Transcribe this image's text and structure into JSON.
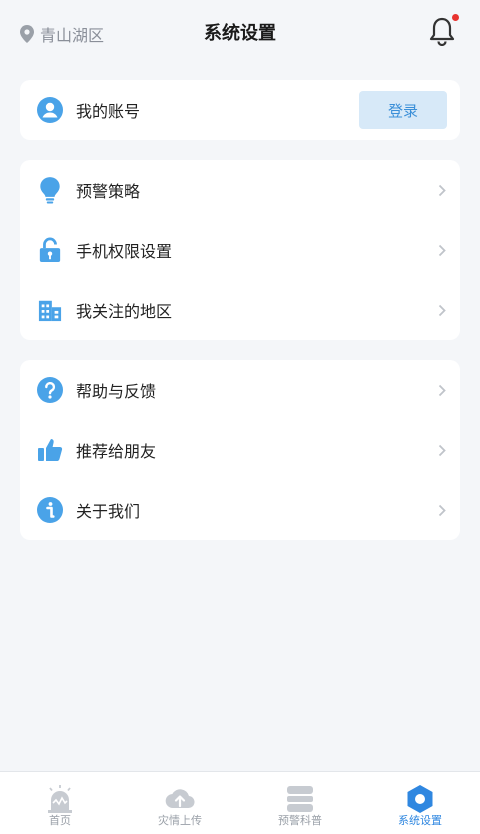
{
  "header": {
    "location": "青山湖区",
    "title": "系统设置"
  },
  "account": {
    "label": "我的账号",
    "login_label": "登录"
  },
  "group1": [
    {
      "label": "预警策略"
    },
    {
      "label": "手机权限设置"
    },
    {
      "label": "我关注的地区"
    }
  ],
  "group2": [
    {
      "label": "帮助与反馈"
    },
    {
      "label": "推荐给朋友"
    },
    {
      "label": "关于我们"
    }
  ],
  "tabs": [
    {
      "label": "首页"
    },
    {
      "label": "灾情上传"
    },
    {
      "label": "预警科普"
    },
    {
      "label": "系统设置"
    }
  ],
  "colors": {
    "accent": "#4aa3e8",
    "active_tab": "#2f87e0",
    "badge": "#e8332f"
  }
}
